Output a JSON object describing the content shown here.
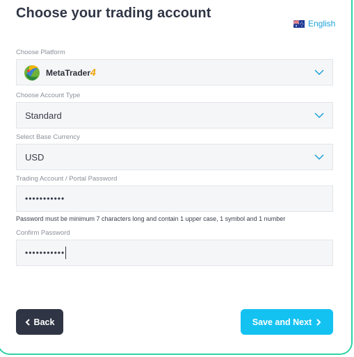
{
  "page": {
    "title": "Choose your trading account"
  },
  "language": {
    "label": "English",
    "icon": "australia-flag-icon"
  },
  "platform": {
    "label": "Choose Platform",
    "value_main": "MetaTrader",
    "value_version": "4",
    "icon": "metatrader-logo-icon"
  },
  "account_type": {
    "label": "Choose Account Type",
    "value": "Standard"
  },
  "currency": {
    "label": "Select Base Currency",
    "value": "USD"
  },
  "password": {
    "label": "Trading Account / Portal Password",
    "value_masked": "•••••••••••",
    "hint": "Password must be minimum 7 characters long and contain 1 upper case, 1 symbol and 1 number"
  },
  "confirm_password": {
    "label": "Confirm Password",
    "value_masked": "•••••••••••"
  },
  "buttons": {
    "back_label": "Back",
    "next_label": "Save and Next"
  },
  "colors": {
    "accent": "#14c2f2",
    "dark_button": "#2f3544",
    "card_border": "#2fd1a3",
    "link": "#1aa0d8"
  }
}
